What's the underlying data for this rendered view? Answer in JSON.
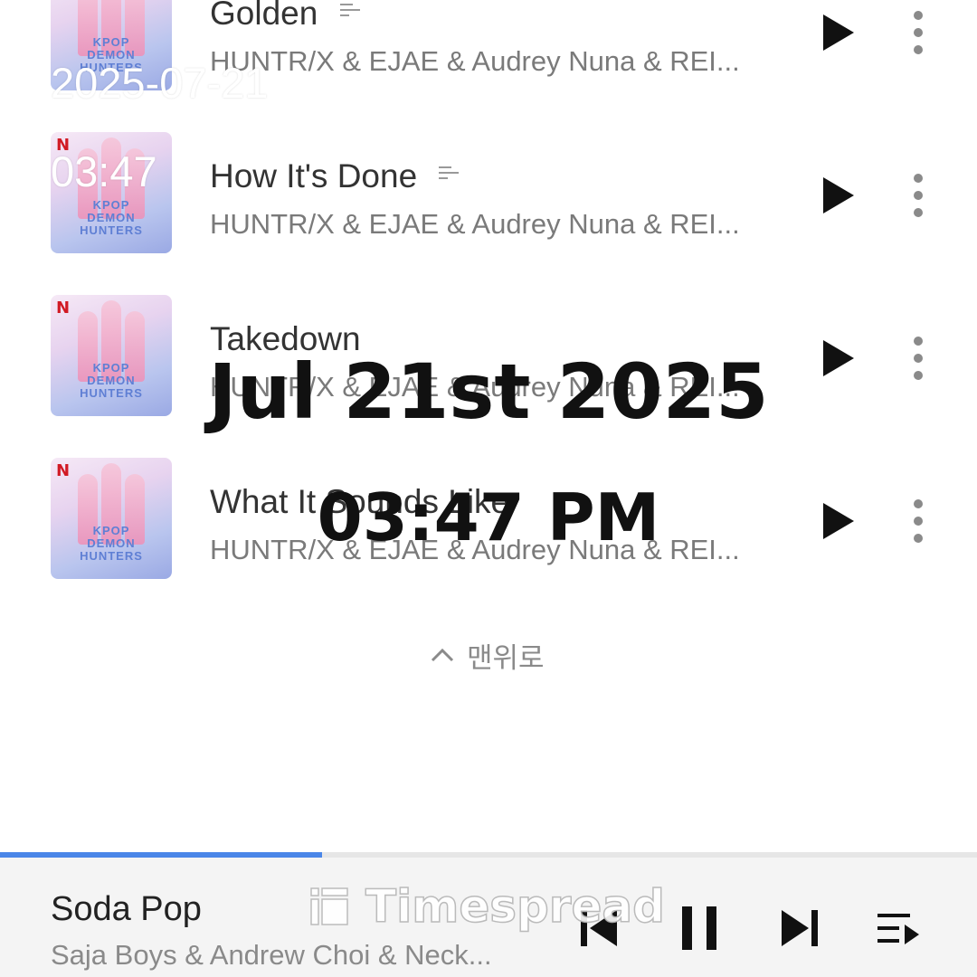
{
  "tracks": [
    {
      "title": "Golden",
      "artist": "HUNTR/X & EJAE & Audrey Nuna & REI...",
      "has_lyrics": true
    },
    {
      "title": "How It's Done",
      "artist": "HUNTR/X & EJAE & Audrey Nuna & REI...",
      "has_lyrics": true
    },
    {
      "title": "Takedown",
      "artist": "HUNTR/X & EJAE & Audrey Nuna & REI...",
      "has_lyrics": false
    },
    {
      "title": "What It Sounds Like",
      "artist": "HUNTR/X & EJAE & Audrey Nuna & REI...",
      "has_lyrics": false
    }
  ],
  "album_art": {
    "badge": "N",
    "caption": "KPOP DEMON HUNTERS"
  },
  "scroll_top_label": "맨위로",
  "now_playing": {
    "title": "Soda Pop",
    "artist": "Saja Boys & Andrew Choi & Neck...",
    "progress": 0.33,
    "state": "playing"
  },
  "overlay": {
    "date_small": "2025-07-21",
    "time_small": "03:47",
    "date_large": "Jul 21st 2025",
    "time_large": "03:47 PM",
    "brand": "Timespread"
  },
  "icons": {
    "track_play": "play-icon",
    "track_more": "more-vertical-icon",
    "lyrics": "lyrics-icon",
    "scroll_top": "chevron-up-icon",
    "prev": "skip-previous-icon",
    "pause": "pause-icon",
    "next": "skip-next-icon",
    "queue": "playlist-queue-icon"
  },
  "colors": {
    "accent": "#4a86e8",
    "netflix_red": "#d11a24"
  }
}
